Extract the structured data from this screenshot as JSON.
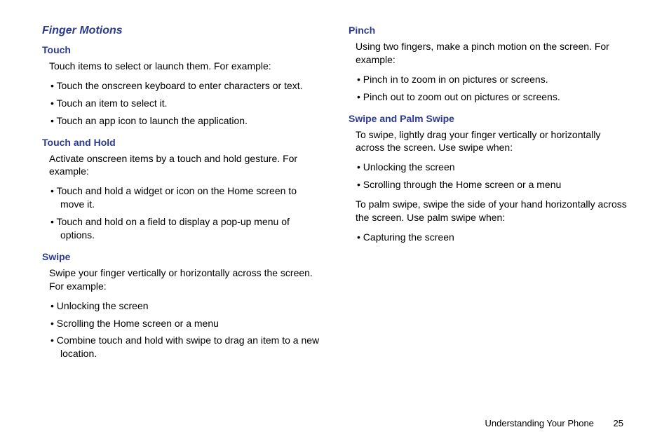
{
  "section_title": "Finger Motions",
  "touch": {
    "heading": "Touch",
    "intro": "Touch items to select or launch them. For example:",
    "items": [
      "Touch the onscreen keyboard to enter characters or text.",
      "Touch an item to select it.",
      "Touch an app icon to launch the application."
    ]
  },
  "touch_hold": {
    "heading": "Touch and Hold",
    "intro": "Activate onscreen items by a touch and hold gesture. For example:",
    "items": [
      "Touch and hold a widget or icon on the Home screen to move it.",
      "Touch and hold on a field to display a pop-up menu of options."
    ]
  },
  "swipe": {
    "heading": "Swipe",
    "intro": "Swipe your finger vertically or horizontally across the screen. For example:",
    "items": [
      "Unlocking the screen",
      "Scrolling the Home screen or a menu",
      "Combine touch and hold with swipe to drag an item to a new location."
    ]
  },
  "pinch": {
    "heading": "Pinch",
    "intro": "Using two fingers, make a pinch motion on the screen. For example:",
    "items": [
      "Pinch in to zoom in on pictures or screens.",
      "Pinch out to zoom out on pictures or screens."
    ]
  },
  "swipe_palm": {
    "heading": "Swipe and Palm Swipe",
    "intro1": "To swipe, lightly drag your finger vertically or horizontally across the screen. Use swipe when:",
    "items1": [
      "Unlocking the screen",
      "Scrolling through the Home screen or a menu"
    ],
    "intro2": "To palm swipe, swipe the side of your hand horizontally across the screen. Use palm swipe when:",
    "items2": [
      "Capturing the screen"
    ]
  },
  "footer": {
    "title": "Understanding Your Phone",
    "page": "25"
  }
}
